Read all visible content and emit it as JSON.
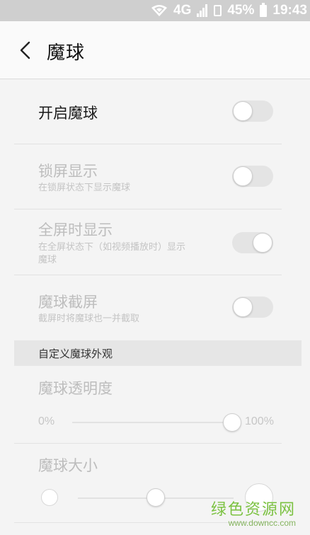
{
  "status_bar": {
    "network": "4G",
    "battery": "45%",
    "time": "19:43"
  },
  "header": {
    "title": "魔球"
  },
  "settings": {
    "enable": {
      "title": "开启魔球",
      "state": "off"
    },
    "lockscreen": {
      "title": "锁屏显示",
      "subtitle": "在锁屏状态下显示魔球",
      "state": "off"
    },
    "fullscreen": {
      "title": "全屏时显示",
      "subtitle_line1": "在全屏状态下（如视频播放时）显示",
      "subtitle_line2": "魔球",
      "state": "on"
    },
    "screenshot": {
      "title": "魔球截屏",
      "subtitle": "截屏时将魔球也一并截取",
      "state": "off"
    }
  },
  "appearance": {
    "section_title": "自定义魔球外观",
    "transparency": {
      "title": "魔球透明度",
      "min_label": "0%",
      "max_label": "100%",
      "value_percent": 100
    },
    "size": {
      "title": "魔球大小",
      "value_fraction": 0.5
    }
  },
  "watermark": {
    "text": "绿色资源网",
    "url": "www.downcc.com"
  },
  "colors": {
    "watermark_green": "#7cc242",
    "disabled_text": "#bdbdbd"
  }
}
